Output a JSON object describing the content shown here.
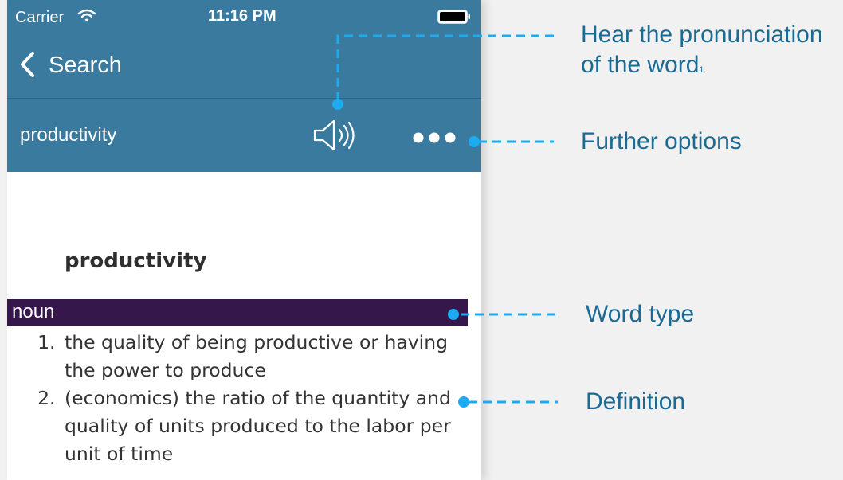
{
  "status_bar": {
    "carrier": "Carrier",
    "time": "11:16 PM"
  },
  "nav": {
    "back_label": "Search"
  },
  "toolbar": {
    "word": "productivity"
  },
  "entry": {
    "word": "productivity",
    "part_of_speech": "noun",
    "definitions": [
      "the quality of being productive or having the power to produce",
      "(economics) the ratio of the quantity and quality of units produced to the labor per unit of time"
    ]
  },
  "annotations": {
    "pronunciation_line1": "Hear the pronunciation",
    "pronunciation_line2": "of the word",
    "pronunciation_note": "1",
    "options": "Further options",
    "word_type": "Word type",
    "definition": "Definition"
  },
  "icons": {
    "back": "chevron-left-icon",
    "speaker": "speaker-icon",
    "more": "more-dots-icon",
    "wifi": "wifi-icon",
    "battery": "battery-icon"
  },
  "colors": {
    "header": "#3a7a9e",
    "word_type_bar": "#36174b",
    "callout_text": "#1b6a94",
    "callout_line": "#1eaaf0"
  }
}
